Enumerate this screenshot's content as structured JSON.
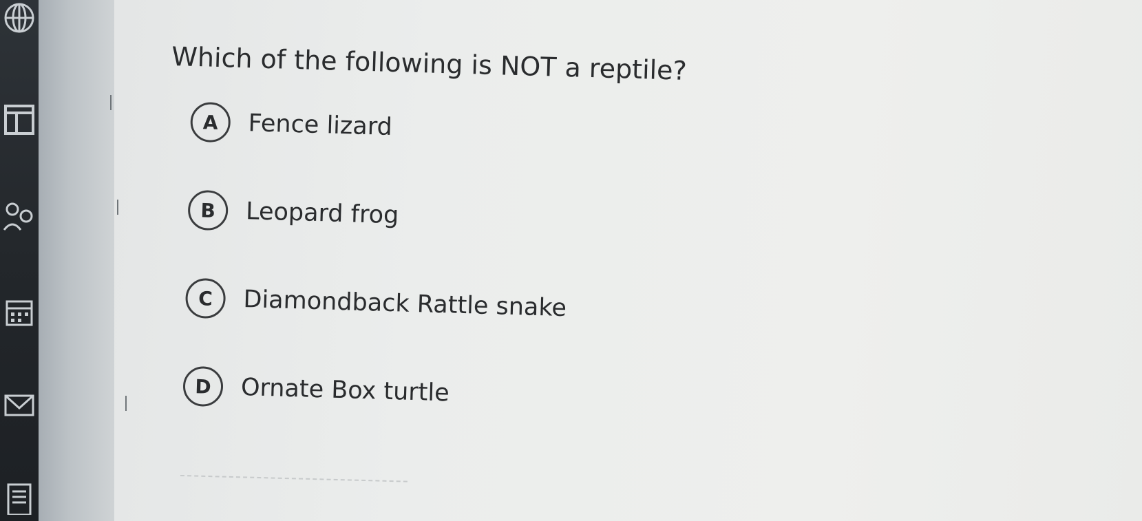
{
  "sidebar": {
    "icons": [
      "globe-icon",
      "layout-icon",
      "people-icon",
      "calendar-icon",
      "mail-icon",
      "document-icon"
    ]
  },
  "quiz": {
    "question": "Which of the following is NOT a reptile?",
    "options": [
      {
        "letter": "A",
        "text": "Fence lizard"
      },
      {
        "letter": "B",
        "text": "Leopard frog"
      },
      {
        "letter": "C",
        "text": "Diamondback Rattle snake"
      },
      {
        "letter": "D",
        "text": "Ornate Box turtle"
      }
    ]
  },
  "colors": {
    "sidebar": "#23272b",
    "text": "#2a2c2e",
    "background": "#eceeed"
  }
}
